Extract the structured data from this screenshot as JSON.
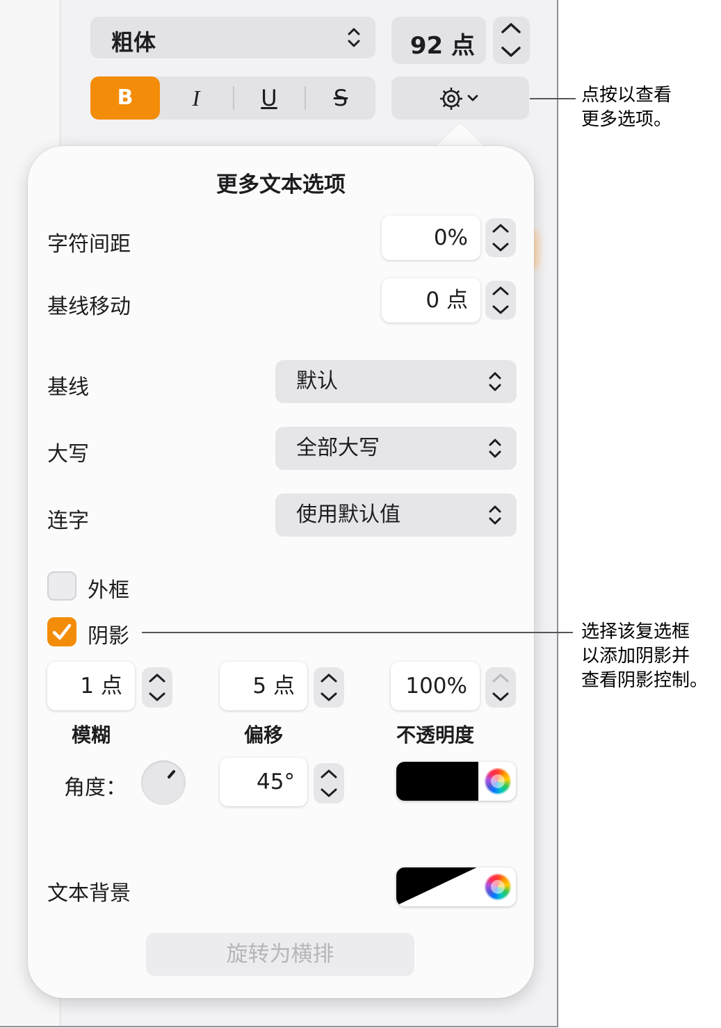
{
  "toolbar": {
    "font_style": "粗体",
    "font_size": "92 点",
    "bold_label": "B",
    "italic_label": "I",
    "underline_label": "U",
    "strikethrough_label": "S"
  },
  "popover": {
    "title": "更多文本选项",
    "character_spacing": {
      "label": "字符间距",
      "value": "0%"
    },
    "baseline_shift": {
      "label": "基线移动",
      "value": "0 点"
    },
    "baseline": {
      "label": "基线",
      "value": "默认"
    },
    "capitalization": {
      "label": "大写",
      "value": "全部大写"
    },
    "ligatures": {
      "label": "连字",
      "value": "使用默认值"
    },
    "outline": {
      "label": "外框",
      "checked": false
    },
    "shadow": {
      "label": "阴影",
      "checked": true,
      "blur": {
        "value": "1 点",
        "label": "模糊"
      },
      "offset": {
        "value": "5 点",
        "label": "偏移"
      },
      "opacity": {
        "value": "100%",
        "label": "不透明度"
      },
      "angle": {
        "label": "角度：",
        "value": "45°"
      },
      "color": "#000000"
    },
    "text_background": {
      "label": "文本背景"
    },
    "rotate_button": "旋转为横排"
  },
  "callouts": {
    "more_options": "点按以查看\n更多选项。",
    "shadow_checkbox": "选择该复选框\n以添加阴影并\n查看阴影控制。"
  },
  "colors": {
    "accent": "#f38c09"
  }
}
